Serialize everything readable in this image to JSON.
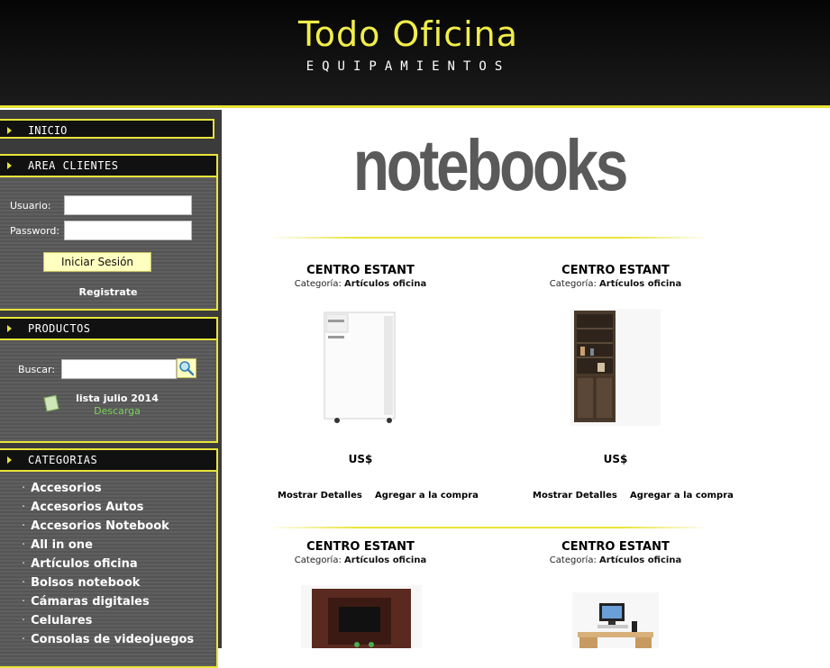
{
  "header": {
    "logo_title": "Todo Oficina",
    "logo_subtitle": "EQUIPAMIENTOS"
  },
  "sidebar": {
    "inicio": "INICIO",
    "area_clientes": {
      "title": "AREA CLIENTES",
      "usuario_label": "Usuario:",
      "password_label": "Password:",
      "login_button": "Iniciar Sesión",
      "register_link": "Registrate"
    },
    "productos": {
      "title": "PRODUCTOS",
      "search_label": "Buscar:",
      "lista_link": "lista julio 2014",
      "descarga_link": "Descarga"
    },
    "categorias": {
      "title": "CATEGORIAS",
      "items": [
        "Accesorios",
        "Accesorios Autos",
        "Accesorios Notebook",
        "All in one",
        "Artículos oficina",
        "Bolsos notebook",
        "Cámaras digitales",
        "Celulares",
        "Consolas de videojuegos"
      ]
    }
  },
  "main": {
    "title": "notebooks",
    "products": [
      {
        "name": "CENTRO ESTANT",
        "cat_label": "Categoría:",
        "cat_value": "Artículos oficina",
        "price": "US$",
        "details": "Mostrar Detalles",
        "buy": "Agregar a la compra"
      },
      {
        "name": "CENTRO ESTANT",
        "cat_label": "Categoría:",
        "cat_value": "Artículos oficina",
        "price": "US$",
        "details": "Mostrar Detalles",
        "buy": "Agregar a la compra"
      },
      {
        "name": "CENTRO ESTANT",
        "cat_label": "Categoría:",
        "cat_value": "Artículos oficina"
      },
      {
        "name": "CENTRO ESTANT",
        "cat_label": "Categoría:",
        "cat_value": "Artículos oficina"
      }
    ]
  },
  "colors": {
    "accent": "#e8e43a",
    "header_bg": "#111111",
    "sidebar_bg": "#5a5a5a",
    "title_gray": "#5a5a5a"
  }
}
